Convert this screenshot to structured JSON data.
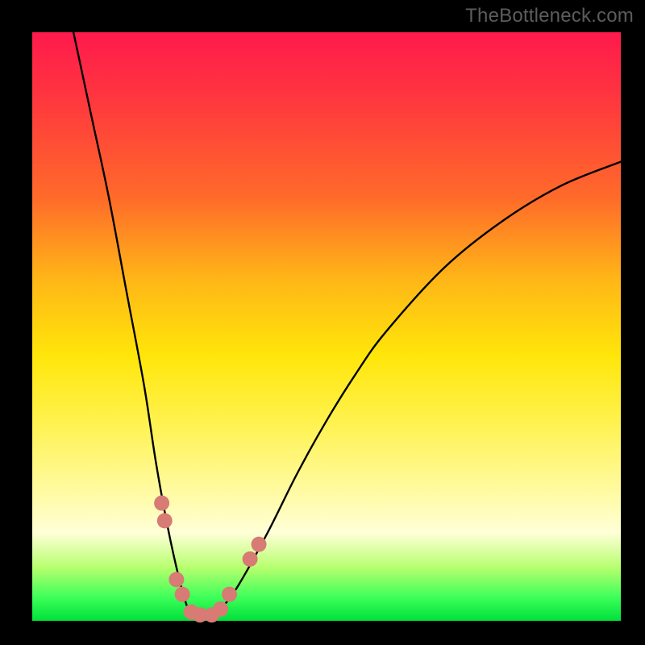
{
  "watermark": "TheBottleneck.com",
  "chart_data": {
    "type": "line",
    "title": "",
    "xlabel": "",
    "ylabel": "",
    "xlim": [
      0,
      100
    ],
    "ylim": [
      0,
      100
    ],
    "series": [
      {
        "name": "bottleneck-curve",
        "x": [
          7,
          10,
          13,
          16,
          19,
          21,
          23,
          25,
          26.5,
          28,
          30,
          32,
          35,
          40,
          45,
          50,
          55,
          60,
          70,
          80,
          90,
          100
        ],
        "values": [
          100,
          86,
          72,
          56,
          40,
          27,
          16,
          7,
          2,
          0.5,
          0.5,
          2,
          6,
          15,
          25,
          34,
          42,
          49,
          60,
          68,
          74,
          78
        ]
      }
    ],
    "markers": [
      {
        "name": "left-threshold-1",
        "x": 22.0,
        "y": 20.0,
        "color": "#d77b74"
      },
      {
        "name": "left-threshold-2",
        "x": 22.5,
        "y": 17.0,
        "color": "#d77b74"
      },
      {
        "name": "left-threshold-3",
        "x": 24.5,
        "y": 7.0,
        "color": "#d77b74"
      },
      {
        "name": "left-threshold-4",
        "x": 25.5,
        "y": 4.5,
        "color": "#d77b74"
      },
      {
        "name": "trough-1",
        "x": 27.0,
        "y": 1.5,
        "color": "#d77b74"
      },
      {
        "name": "trough-2",
        "x": 28.5,
        "y": 1.0,
        "color": "#d77b74"
      },
      {
        "name": "trough-3",
        "x": 30.5,
        "y": 1.0,
        "color": "#d77b74"
      },
      {
        "name": "trough-4",
        "x": 32.0,
        "y": 2.0,
        "color": "#d77b74"
      },
      {
        "name": "right-threshold-1",
        "x": 33.5,
        "y": 4.5,
        "color": "#d77b74"
      },
      {
        "name": "right-threshold-2",
        "x": 37.0,
        "y": 10.5,
        "color": "#d77b74"
      },
      {
        "name": "right-threshold-3",
        "x": 38.5,
        "y": 13.0,
        "color": "#d77b74"
      }
    ],
    "gradient_stops": [
      {
        "pos": 0,
        "color": "#ff1a4d"
      },
      {
        "pos": 28,
        "color": "#ff6a2a"
      },
      {
        "pos": 55,
        "color": "#ffe60a"
      },
      {
        "pos": 85,
        "color": "#ffffd8"
      },
      {
        "pos": 100,
        "color": "#00e03a"
      }
    ]
  }
}
